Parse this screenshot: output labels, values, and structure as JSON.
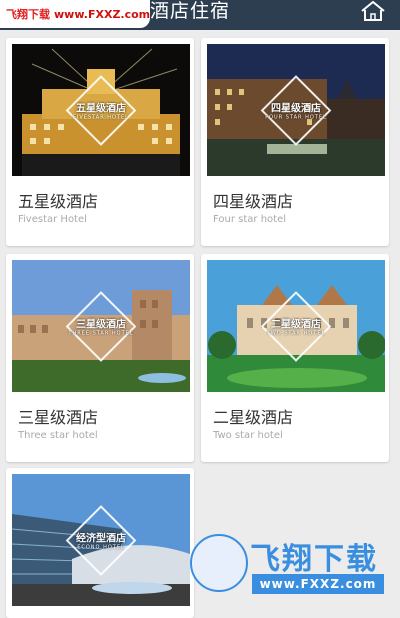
{
  "header": {
    "title": "酒店住宿",
    "home_icon": "home-icon"
  },
  "watermark": {
    "brand": "飞翔下载",
    "url": "www.FXXZ.com",
    "logo_text": "飞翔下载",
    "logo_url": "www.FXXZ.com"
  },
  "hotels": [
    {
      "title": "五星级酒店",
      "subtitle": "Fivestar Hotel",
      "badge_cn": "五星级酒店",
      "badge_en": "FIVESTAR HOTEL"
    },
    {
      "title": "四星级酒店",
      "subtitle": "Four star hotel",
      "badge_cn": "四星级酒店",
      "badge_en": "FOUR STAR HOTEL"
    },
    {
      "title": "三星级酒店",
      "subtitle": "Three star hotel",
      "badge_cn": "三星级酒店",
      "badge_en": "THREE STAR HOTEL"
    },
    {
      "title": "二星级酒店",
      "subtitle": "Two star hotel",
      "badge_cn": "二星级酒店",
      "badge_en": "TWO STAR HOTEL"
    },
    {
      "title": "",
      "subtitle": "",
      "badge_cn": "经济型酒店",
      "badge_en": "ECONO HOTEL"
    }
  ],
  "colors": {
    "header_bg": "#2c3e50",
    "page_bg": "#ececec",
    "watermark_red": "#e02020",
    "logo_blue": "#3a8ee0"
  }
}
